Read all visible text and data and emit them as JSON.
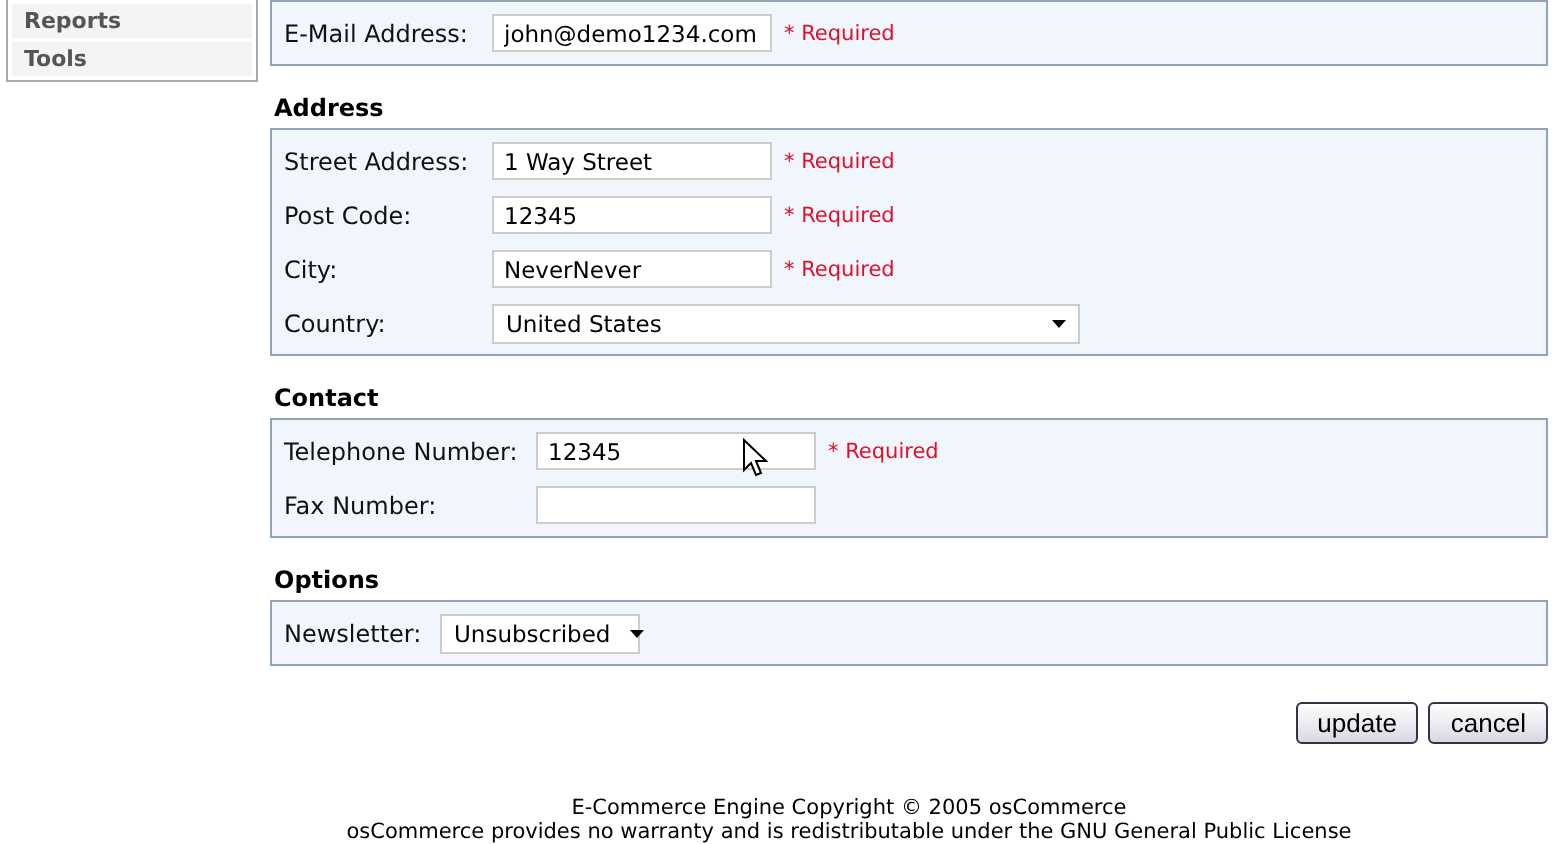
{
  "sidebar": {
    "items": [
      {
        "label": "Reports"
      },
      {
        "label": "Tools"
      }
    ]
  },
  "sections": [
    {
      "fields": [
        {
          "label": "E-Mail Address:",
          "kind": "text",
          "value": "john@demo1234.com",
          "note": "* Required"
        }
      ]
    },
    {
      "title": "Address",
      "fields": [
        {
          "label": "Street Address:",
          "kind": "text",
          "value": "1 Way Street",
          "note": "* Required"
        },
        {
          "label": "Post Code:",
          "kind": "text",
          "value": "12345",
          "note": "* Required"
        },
        {
          "label": "City:",
          "kind": "text",
          "value": "NeverNever",
          "note": "* Required"
        },
        {
          "label": "Country:",
          "kind": "select",
          "value": "United States"
        }
      ]
    },
    {
      "title": "Contact",
      "fields": [
        {
          "label": "Telephone Number:",
          "kind": "text",
          "value": "12345",
          "note": "* Required"
        },
        {
          "label": "Fax Number:",
          "kind": "text"
        }
      ]
    },
    {
      "title": "Options",
      "fields": [
        {
          "label": "Newsletter:",
          "kind": "select",
          "value": "Unsubscribed"
        }
      ]
    }
  ],
  "buttons": [
    "update",
    "cancel"
  ],
  "footer": [
    "E-Commerce Engine Copyright © 2005 osCommerce",
    "osCommerce provides no warranty and is redistributable under the GNU General Public License"
  ]
}
